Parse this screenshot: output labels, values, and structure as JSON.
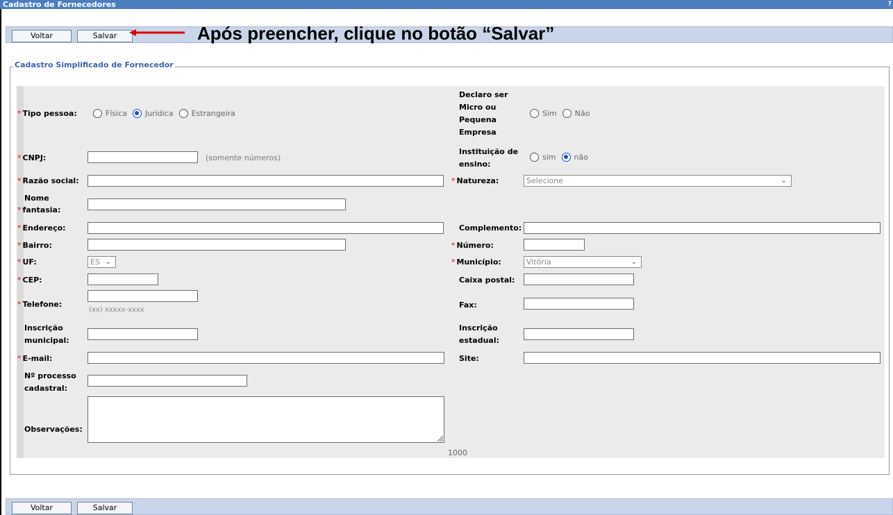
{
  "window": {
    "title": "Cadastro de Fornecedores",
    "corner": "?"
  },
  "toolbar": {
    "voltar_label": "Voltar",
    "salvar_label": "Salvar"
  },
  "annotation": {
    "text": "Após preencher, clique no botão “Salvar”"
  },
  "section": {
    "legend": "Cadastro Simplificado de Fornecedor"
  },
  "fields": {
    "tipo_pessoa": {
      "label": "Tipo pessoa:",
      "options": [
        "Física",
        "Jurídica",
        "Estrangeira"
      ],
      "selected": "Jurídica"
    },
    "micro_empresa": {
      "label_lines": [
        "Declaro ser",
        "Micro ou",
        "Pequena",
        "Empresa"
      ],
      "options": [
        "Sim",
        "Não"
      ],
      "selected": ""
    },
    "cnpj": {
      "label": "CNPJ:",
      "hint": "(somente números)",
      "value": ""
    },
    "instituicao_ensino": {
      "label_lines": [
        "Instituição de",
        "ensino:"
      ],
      "options": [
        "sim",
        "não"
      ],
      "selected": "não"
    },
    "razao_social": {
      "label": "Razão social:",
      "value": ""
    },
    "natureza": {
      "label": "Natureza:",
      "selected": "Selecione"
    },
    "nome_fantasia": {
      "label_lines": [
        "Nome",
        "fantasia:"
      ],
      "value": ""
    },
    "endereco": {
      "label": "Endereço:",
      "value": ""
    },
    "complemento": {
      "label": "Complemento:",
      "value": ""
    },
    "bairro": {
      "label": "Bairro:",
      "value": ""
    },
    "numero": {
      "label": "Número:",
      "value": ""
    },
    "uf": {
      "label": "UF:",
      "selected": "ES"
    },
    "municipio": {
      "label": "Município:",
      "selected": "Vitória"
    },
    "cep": {
      "label": "CEP:",
      "value": ""
    },
    "caixa_postal": {
      "label": "Caixa postal:",
      "value": ""
    },
    "telefone": {
      "label": "Telefone:",
      "hint": "(xx) xxxxx-xxxx",
      "value": ""
    },
    "fax": {
      "label": "Fax:",
      "value": ""
    },
    "inscricao_municipal": {
      "label_lines": [
        "Inscrição",
        "municipal:"
      ],
      "value": ""
    },
    "inscricao_estadual": {
      "label_lines": [
        "Inscrição",
        "estadual:"
      ],
      "value": ""
    },
    "email": {
      "label": "E-mail:",
      "value": ""
    },
    "site": {
      "label": "Site:",
      "value": ""
    },
    "processo_cadastral": {
      "label_lines": [
        "Nº processo",
        "cadastral:"
      ],
      "value": ""
    },
    "observacoes": {
      "label": "Observações:",
      "value": "",
      "counter": "1000"
    }
  },
  "colors": {
    "title_bar": "#4a7ec0",
    "toolbar": "#c9d5e8",
    "required_star": "#dd1111",
    "arrow": "#e00000",
    "legend_text": "#3c63a8"
  }
}
